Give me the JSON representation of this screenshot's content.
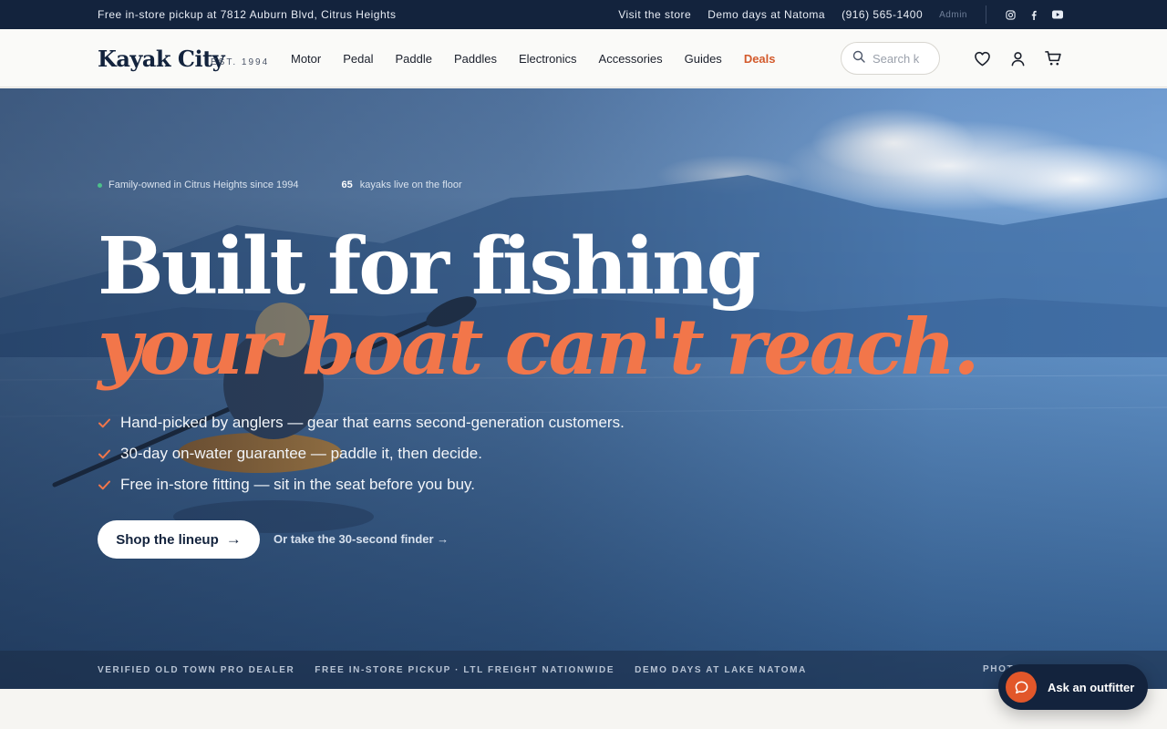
{
  "topbar": {
    "pickup_text": "Free in-store pickup at 7812 Auburn Blvd, Citrus Heights",
    "visit_store": "Visit the store",
    "demo_days": "Demo days at Natoma",
    "phone": "(916) 565-1400",
    "admin": "Admin",
    "social_icons": [
      "instagram-icon",
      "facebook-icon",
      "youtube-icon"
    ]
  },
  "header": {
    "logo": "Kayak City",
    "established": "EST. 1994",
    "nav": [
      "Motor",
      "Pedal",
      "Paddle",
      "Paddles",
      "Electronics",
      "Accessories",
      "Guides",
      "Deals"
    ],
    "search_placeholder": "Search k",
    "icons": [
      "heart-icon",
      "user-icon",
      "cart-icon"
    ]
  },
  "hero": {
    "eyebrow_text": "Family-owned in Citrus Heights since 1994",
    "live_count": "65",
    "live_text": "kayaks live on the floor",
    "headline_line1": "Built for fishing",
    "headline_line2": "your boat can't reach.",
    "bullets": [
      "Hand-picked by anglers — gear that earns second-generation customers.",
      "30-day on-water guarantee — paddle it, then decide.",
      "Free in-store fitting — sit in the seat before you buy."
    ],
    "cta_label": "Shop the lineup",
    "cta_arrow": "→",
    "finder_link": "Or take the 30-second finder →"
  },
  "strip": {
    "items": [
      "VERIFIED OLD TOWN PRO DEALER",
      "FREE IN-STORE PICKUP · LTL FREIGHT NATIONWIDE",
      "DEMO DAYS AT LAKE NATOMA"
    ],
    "photo_credit": "PHOT"
  },
  "chat": {
    "label": "Ask an outfitter"
  },
  "colors": {
    "navy": "#13233d",
    "accent": "#f2764a",
    "deals": "#d35a2c",
    "live_dot": "#4cc08a"
  }
}
